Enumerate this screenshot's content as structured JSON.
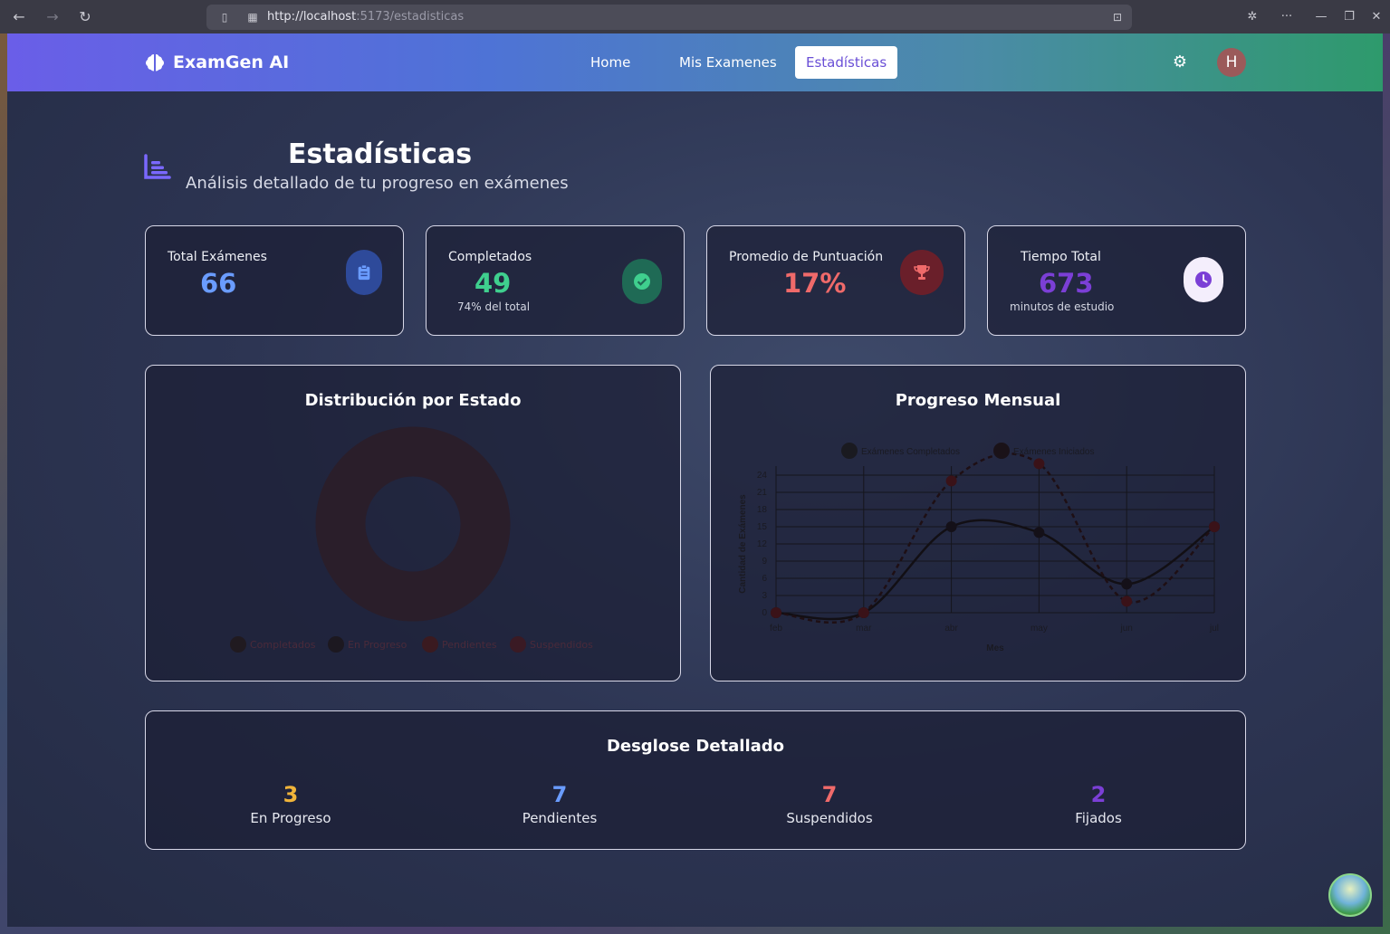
{
  "browser": {
    "url_host": "http://localhost",
    "url_path": ":5173/estadisticas"
  },
  "navbar": {
    "brand": "ExamGen AI",
    "links": [
      {
        "label": "Home"
      },
      {
        "label": "Mis Examenes"
      },
      {
        "label": "Estadísticas",
        "active": true
      }
    ],
    "avatar_initial": "H"
  },
  "header": {
    "title": "Estadísticas",
    "subtitle": "Análisis detallado de tu progreso en exámenes"
  },
  "stats": [
    {
      "label": "Total Exámenes",
      "value": "66",
      "note": "",
      "color": "#6a9cff",
      "icon": "clipboard-icon"
    },
    {
      "label": "Completados",
      "value": "49",
      "note": "74% del total",
      "color": "#3fcf8e",
      "icon": "check-circle-icon"
    },
    {
      "label": "Promedio de Puntuación",
      "value": "17%",
      "note": "",
      "color": "#f06a6a",
      "icon": "trophy-icon"
    },
    {
      "label": "Tiempo Total",
      "value": "673",
      "note": "minutos de estudio",
      "color": "#7b3fd6",
      "icon": "clock-icon"
    }
  ],
  "distribution": {
    "title": "Distribución por Estado",
    "legend": [
      "Completados",
      "En Progreso",
      "Pendientes",
      "Suspendidos"
    ]
  },
  "monthly": {
    "title": "Progreso Mensual"
  },
  "chart_data": {
    "type": "line",
    "title": "Progreso Mensual",
    "xlabel": "Mes",
    "ylabel": "Cantidad de Exámenes",
    "categories": [
      "feb",
      "mar",
      "abr",
      "may",
      "jun",
      "jul"
    ],
    "ylim": [
      0,
      24
    ],
    "yticks": [
      0,
      3,
      6,
      9,
      12,
      15,
      18,
      21,
      24
    ],
    "grid": true,
    "legend_position": "top",
    "series": [
      {
        "name": "Exámenes Completados",
        "values": [
          0,
          0,
          15,
          14,
          5,
          15
        ],
        "style": "solid"
      },
      {
        "name": "Exámenes Iniciados",
        "values": [
          0,
          0,
          23,
          26,
          2,
          15
        ],
        "style": "dashed"
      }
    ]
  },
  "breakdown": {
    "title": "Desglose Detallado",
    "items": [
      {
        "value": "3",
        "label": "En Progreso",
        "color": "#f0b43a"
      },
      {
        "value": "7",
        "label": "Pendientes",
        "color": "#6a9cff"
      },
      {
        "value": "7",
        "label": "Suspendidos",
        "color": "#f06a6a"
      },
      {
        "value": "2",
        "label": "Fijados",
        "color": "#7b3fd6"
      }
    ]
  }
}
